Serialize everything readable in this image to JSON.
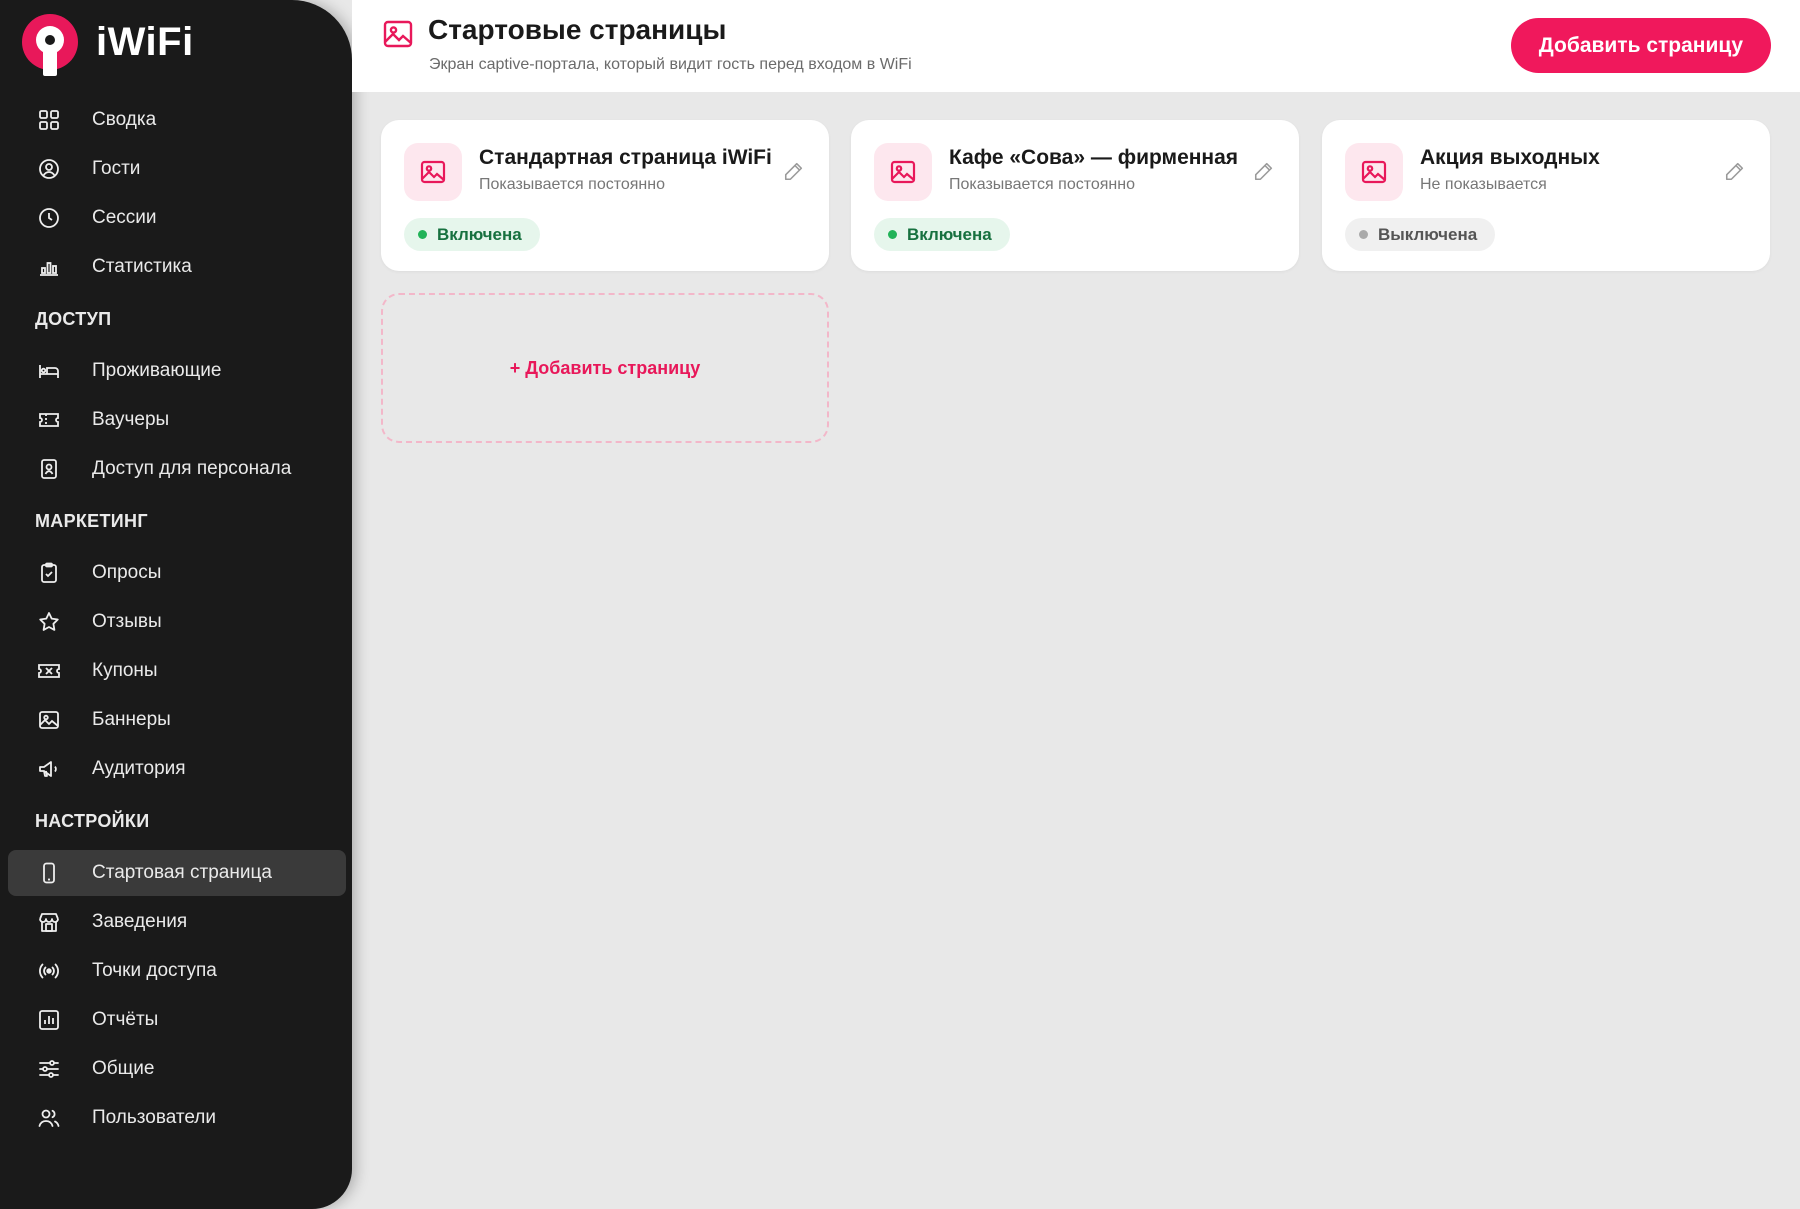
{
  "app": {
    "logo_text": "iWiFi"
  },
  "sidebar": {
    "top_items": [
      {
        "label": "Сводка",
        "icon": "dashboard-icon"
      },
      {
        "label": "Гости",
        "icon": "user-circle-icon"
      },
      {
        "label": "Сессии",
        "icon": "clock-icon"
      },
      {
        "label": "Статистика",
        "icon": "bar-chart-icon"
      }
    ],
    "sections": [
      {
        "title": "ДОСТУП",
        "items": [
          {
            "label": "Проживающие",
            "icon": "bed-icon"
          },
          {
            "label": "Ваучеры",
            "icon": "ticket-icon"
          },
          {
            "label": "Доступ для персонала",
            "icon": "badge-icon"
          }
        ]
      },
      {
        "title": "МАРКЕТИНГ",
        "items": [
          {
            "label": "Опросы",
            "icon": "clipboard-check-icon"
          },
          {
            "label": "Отзывы",
            "icon": "star-icon"
          },
          {
            "label": "Купоны",
            "icon": "coupon-icon"
          },
          {
            "label": "Баннеры",
            "icon": "image-icon"
          },
          {
            "label": "Аудитория",
            "icon": "megaphone-icon"
          }
        ]
      },
      {
        "title": "НАСТРОЙКИ",
        "items": [
          {
            "label": "Стартовая страница",
            "icon": "phone-icon",
            "active": true
          },
          {
            "label": "Заведения",
            "icon": "store-icon"
          },
          {
            "label": "Точки доступа",
            "icon": "broadcast-icon"
          },
          {
            "label": "Отчёты",
            "icon": "report-icon"
          },
          {
            "label": "Общие",
            "icon": "sliders-icon"
          },
          {
            "label": "Пользователи",
            "icon": "users-icon"
          }
        ]
      }
    ]
  },
  "header": {
    "icon": "image-icon",
    "title": "Стартовые страницы",
    "subtitle": "Экран captive-портала, который видит гость перед входом в WiFi",
    "add_button_label": "Добавить страницу"
  },
  "cards": [
    {
      "name": "Стандартная страница iWiFi",
      "description": "Показывается постоянно",
      "status": "Включена",
      "enabled": true
    },
    {
      "name": "Кафе «Сова» — фирменная",
      "description": "Показывается постоянно",
      "status": "Включена",
      "enabled": true
    },
    {
      "name": "Акция выходных",
      "description": "Не показывается",
      "status": "Выключена",
      "enabled": false
    }
  ],
  "add_card_label": "+ Добавить страницу",
  "colors": {
    "accent": "#f0185c",
    "sidebar_bg": "#1a1a1a",
    "content_bg": "#e8e8e8",
    "success": "#22b358"
  }
}
